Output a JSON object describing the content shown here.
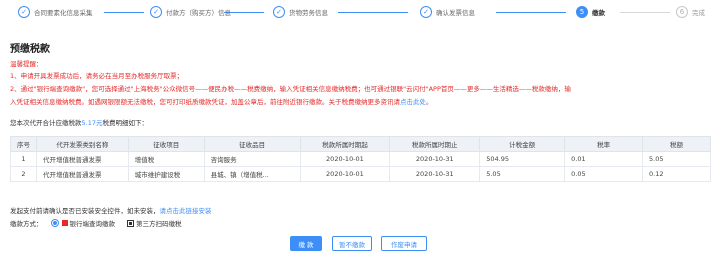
{
  "stepper": {
    "steps": [
      {
        "label": "合同要素化信息采集",
        "status": "done",
        "mark": "✓"
      },
      {
        "label": "付款方（购买方）信息",
        "status": "done",
        "mark": "✓"
      },
      {
        "label": "货物劳务信息",
        "status": "done",
        "mark": "✓"
      },
      {
        "label": "确认发票信息",
        "status": "done",
        "mark": "✓"
      },
      {
        "label": "缴款",
        "status": "active",
        "mark": "5"
      },
      {
        "label": "完成",
        "status": "todo",
        "mark": "6"
      }
    ]
  },
  "page_title": "预缴税款",
  "notice": {
    "heading": "温馨提醒：",
    "line1": "1、申请开具发票成功后，请务必在当月至办税服务厅取票；",
    "line2": "2、通过\"银行端查询缴款\"，您可选择通过\"上海税务\"公众微信号——便民办税——税费缴纳，输入凭证相关信息缴纳税费；也可通过银联\"云闪付\"APP首页——更多——生活精选——税款缴纳，输",
    "line3_text": "入凭证相关信息缴纳税费。如遇网银限额无法缴税，您可打印纸质缴款凭证，加盖公章后，前往附近银行缴款。关于税费缴纳更多资讯请",
    "line3_link": "点击此处",
    "line3_end": "。"
  },
  "summary": {
    "prefix": "您本次代开合计应缴税款",
    "amount": "5.17元",
    "suffix": "税费明细如下："
  },
  "table": {
    "headers": [
      "序号",
      "代开发票类别名称",
      "征收项目",
      "征收品目",
      "税款所属时期起",
      "税款所属时期止",
      "计税金额",
      "税率",
      "税额"
    ],
    "rows": [
      {
        "no": "1",
        "type": "代开增值税普通发票",
        "item": "增值税",
        "subitem": "咨询服务",
        "from": "2020-10-01",
        "to": "2020-10-31",
        "base": "504.95",
        "rate": "0.01",
        "tax": "5.05"
      },
      {
        "no": "2",
        "type": "代开增值税普通发票",
        "item": "城市维护建设税",
        "subitem": "县城、镇（增值税...",
        "from": "2020-10-01",
        "to": "2020-10-31",
        "base": "5.05",
        "rate": "0.05",
        "tax": "0.12"
      }
    ]
  },
  "install_notice": {
    "text": "发起支付前请确认是否已安装安全控件，如未安装，",
    "link": "请点击此链接安装"
  },
  "payment": {
    "label": "缴款方式：",
    "option1": "银行端查询缴款",
    "option2": "第三方扫码缴税"
  },
  "buttons": {
    "pay": "缴 款",
    "later": "暂不缴款",
    "void": "作废申请"
  },
  "colors": {
    "accent": "#3e8ef7",
    "warning": "#e42a2a"
  }
}
